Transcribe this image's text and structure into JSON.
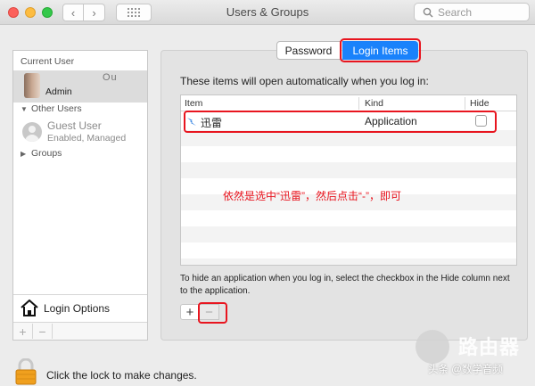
{
  "window": {
    "title": "Users & Groups"
  },
  "toolbar": {
    "search_placeholder": "Search"
  },
  "sidebar": {
    "current_user_label": "Current User",
    "current_user_name": "Ou",
    "current_user_role": "Admin",
    "other_users_label": "Other Users",
    "guest_name": "Guest User",
    "guest_status": "Enabled, Managed",
    "groups_label": "Groups",
    "login_options_label": "Login Options",
    "add_label": "+",
    "remove_label": "−"
  },
  "tabs": [
    {
      "label": "Password",
      "selected": false
    },
    {
      "label": "Login Items",
      "selected": true
    }
  ],
  "main": {
    "intro": "These items will open automatically when you log in:",
    "columns": [
      "Item",
      "Kind",
      "Hide"
    ],
    "rows": [
      {
        "item": "迅雷",
        "kind": "Application",
        "hide": false
      }
    ],
    "annotation": "依然是选中“迅雷”，然后点击“-”，即可",
    "note": "To hide an application when you log in, select the checkbox in the Hide column next to the application.",
    "add_label": "+",
    "remove_label": "−"
  },
  "footer": {
    "lock_text": "Click the lock to make changes."
  },
  "watermark": {
    "brand": "路由器",
    "credit": "头条 @数学音频"
  },
  "colors": {
    "accent": "#1a82fb",
    "highlight": "#e8151f",
    "lock": "#f0a01e"
  }
}
